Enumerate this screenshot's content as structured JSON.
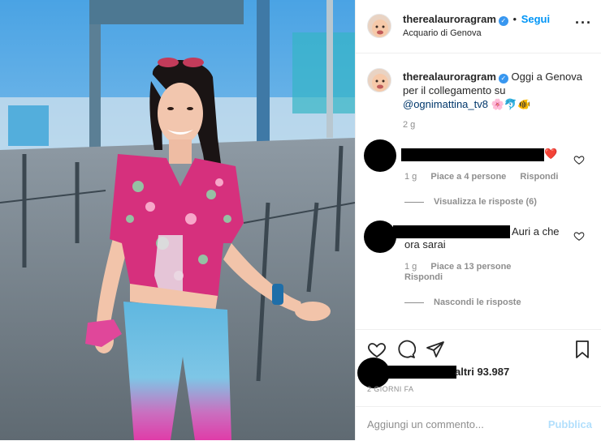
{
  "post": {
    "username": "therealauroragram",
    "follow_label": "Segui",
    "location": "Acquario di Genova",
    "caption_text": "Oggi a Genova per il collegamento su",
    "caption_mention": "@ognimattina_tv8",
    "caption_emoji": "🌸🐬🐠",
    "caption_time": "2 g"
  },
  "comments": [
    {
      "emoji": "❤️",
      "time": "1 g",
      "likes": "Piace a 4 persone",
      "reply": "Rispondi",
      "toggle_replies": "Visualizza le risposte (6)"
    },
    {
      "text_end": "Auri a che",
      "text_line2": "ora sarai",
      "time": "1 g",
      "likes": "Piace a 13 persone",
      "reply": "Rispondi",
      "toggle_replies": "Nascondi le risposte"
    }
  ],
  "footer": {
    "likes_suffix": "altri 93.987",
    "date": "2 GIORNI FA",
    "comment_placeholder": "Aggiungi un commento...",
    "publish_label": "Pubblica"
  },
  "colors": {
    "accent": "#0095f6",
    "verified": "#3897f0",
    "publish_disabled": "#b2dffc"
  }
}
